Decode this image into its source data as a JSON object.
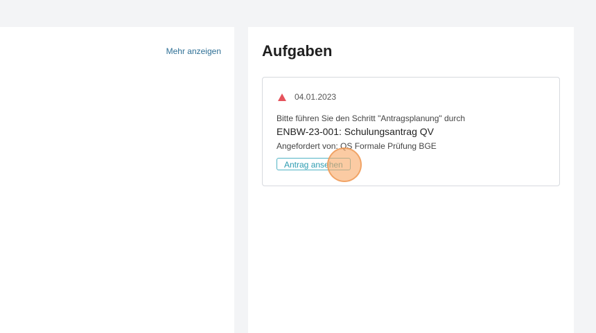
{
  "left_panel": {
    "more_link": "Mehr anzeigen"
  },
  "tasks_panel": {
    "title": "Aufgaben",
    "task": {
      "status_icon": "warning-triangle-icon",
      "status_color": "#e5535c",
      "date": "04.01.2023",
      "instruction": "Bitte führen Sie den Schritt \"Antragsplanung\" durch",
      "name": "ENBW-23-001: Schulungsantrag QV",
      "requested_by": "Angefordert von: QS Formale Prüfung BGE",
      "action_label": "Antrag ansehen"
    }
  },
  "colors": {
    "background": "#f3f4f6",
    "link": "#2e6f95",
    "button_accent": "#2b9bb0",
    "click_marker": "#f8a866"
  }
}
